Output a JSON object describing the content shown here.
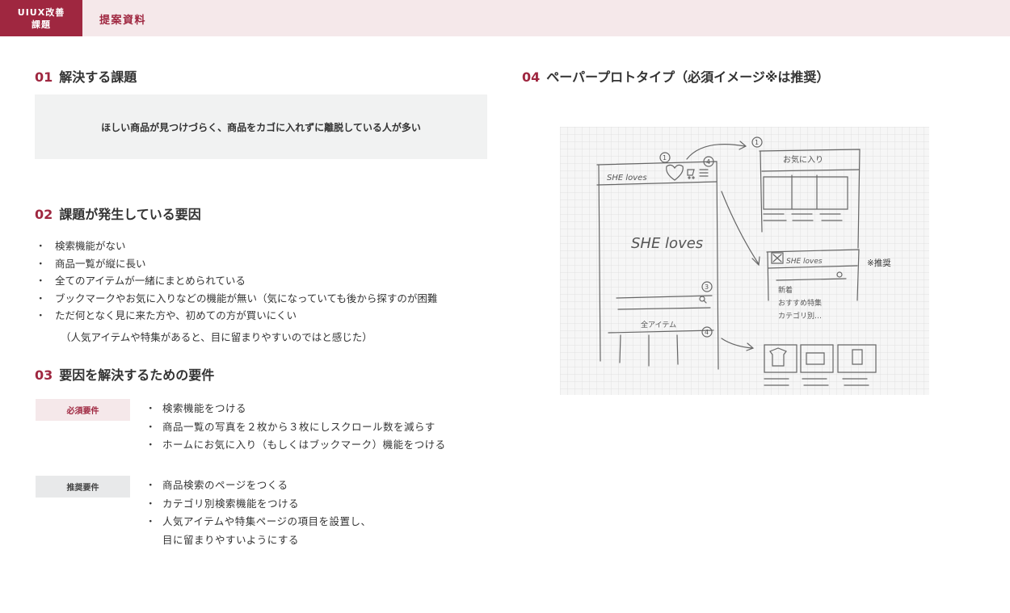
{
  "header": {
    "brand_line1": "UIUX改善",
    "brand_line2": "課題",
    "doc_label": "提案資料"
  },
  "section1": {
    "num": "01",
    "title": "解決する課題",
    "problem": "ほしい商品が見つけづらく、商品をカゴに入れずに離脱している人が多い"
  },
  "section2": {
    "num": "02",
    "title": "課題が発生している要因",
    "bullet": "・",
    "causes": [
      "検索機能がない",
      "商品一覧が縦に長い",
      "全てのアイテムが一緒にまとめられている",
      "ブックマークやお気に入りなどの機能が無い（気になっていても後から探すのが困難",
      "ただ何となく見に来た方や、初めての方が買いにくい"
    ],
    "cause_note": "（人気アイテムや特集があると、目に留まりやすいのではと感じた）"
  },
  "section3": {
    "num": "03",
    "title": "要因を解決するための要件",
    "bullet": "・",
    "required": {
      "label": "必須要件",
      "items": [
        "検索機能をつける",
        "商品一覧の写真を２枚から３枚にしスクロール数を減らす",
        "ホームにお気に入り（もしくはブックマーク）機能をつける"
      ]
    },
    "recommended": {
      "label": "推奨要件",
      "items": [
        "商品検索のページをつくる",
        "カテゴリ別検索機能をつける",
        "人気アイテムや特集ページの項目を設置し、"
      ],
      "continuation": "目に留まりやすいようにする"
    }
  },
  "section4": {
    "num": "04",
    "title": "ペーパープロトタイプ（必須イメージ※は推奨）",
    "sketch": {
      "logo_small": "SHE loves",
      "logo_large": "SHE loves",
      "marker_1": "1",
      "marker_3": "3",
      "marker_4": "4",
      "all_items": "全アイテム",
      "favorites": "お気に入り",
      "categories": [
        "新着",
        "おすすめ特集",
        "カテゴリ別…"
      ],
      "note": "※推奨"
    }
  },
  "colors": {
    "accent": "#9f2740",
    "accent_light": "#f5e8ea",
    "box_gray": "#f1f2f2",
    "text": "#333333"
  }
}
